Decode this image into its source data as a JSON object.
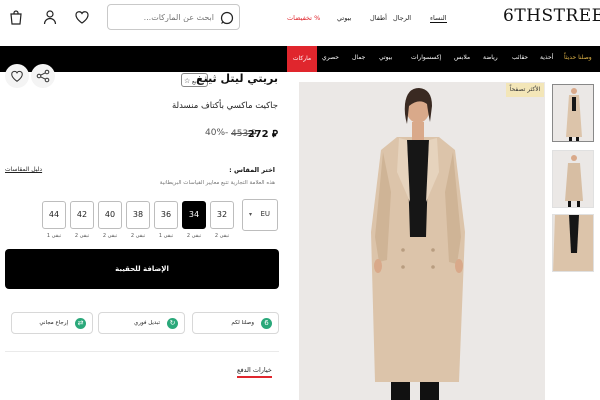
{
  "header": {
    "logo": "6THSTREET",
    "search_placeholder": "ابحث عن الماركات...",
    "nav": {
      "women": "النساء",
      "men": "الرجال",
      "kids": "أطفال",
      "beauty": "بيوتي",
      "offers": "تخفيضات %"
    }
  },
  "categories": {
    "new_arrivals": "وصلنا حديثاً",
    "shoes": "أحذية",
    "bags": "حقائب",
    "sports": "رياضة",
    "clothing": "ملابس",
    "accessories": "إكسسوارات",
    "beauty": "بيوتي",
    "home": "جمال",
    "exclusive": "حصري",
    "brands": "ماركات"
  },
  "product": {
    "brand": "بريتي ليتل ثينغ",
    "brand_badge": "تابع",
    "name": "جاكيت ماكسي بأكتاف منسدلة",
    "price_current": "272 ⃁",
    "price_old": "453 ⃁",
    "discount": "40%-",
    "size_title": "اختر المقاس :",
    "size_note": "هذه العلامة التجارية تتبع معايير القياسات البريطانية",
    "size_guide": "دليل المقاسات",
    "region": "EU",
    "sizes": [
      {
        "label": "32",
        "stock": "تبقى 2"
      },
      {
        "label": "34",
        "stock": "تبقى 2"
      },
      {
        "label": "36",
        "stock": "تبقى 1"
      },
      {
        "label": "38",
        "stock": "تبقى 2"
      },
      {
        "label": "40",
        "stock": "تبقى 2"
      },
      {
        "label": "42",
        "stock": "تبقى 2"
      },
      {
        "label": "44",
        "stock": "تبقى 1"
      }
    ],
    "selected_size": "34",
    "add_to_bag": "الإضافة للحقيبة",
    "perks": {
      "delivery": "وصلنا لكم",
      "exchange": "تبديل فوري",
      "returns": "إرجاع مجاني"
    },
    "payment_options": "خيارات الدفع",
    "bestseller_badge": "الأكثر تصفحاً"
  },
  "colors": {
    "accent_red": "#e0262d",
    "gold": "#e3b74a",
    "perk_green": "#2aa87a",
    "coat_beige": "#dcc4aa"
  }
}
